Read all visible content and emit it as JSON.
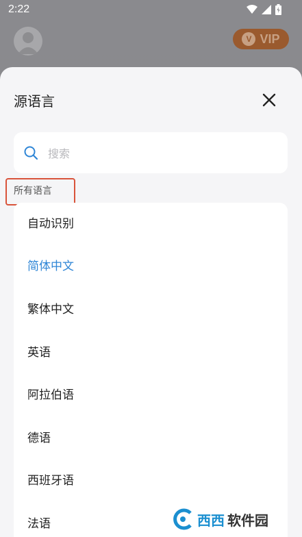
{
  "status_bar": {
    "time": "2:22"
  },
  "background": {
    "vip_label": "VIP",
    "vip_icon_letter": "V"
  },
  "sheet": {
    "title": "源语言",
    "search_placeholder": "搜索",
    "section_label": "所有语言",
    "selected_color": "#2f86d6",
    "languages": [
      {
        "label": "自动识别",
        "selected": false
      },
      {
        "label": "简体中文",
        "selected": true
      },
      {
        "label": "繁体中文",
        "selected": false
      },
      {
        "label": "英语",
        "selected": false
      },
      {
        "label": "阿拉伯语",
        "selected": false
      },
      {
        "label": "德语",
        "selected": false
      },
      {
        "label": "西班牙语",
        "selected": false
      },
      {
        "label": "法语",
        "selected": false
      }
    ]
  },
  "watermark": {
    "part1": "西西",
    "part2": "软件园"
  }
}
